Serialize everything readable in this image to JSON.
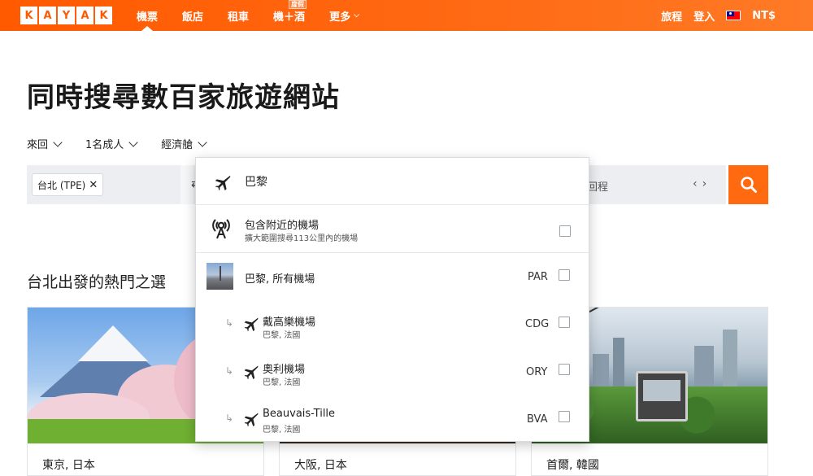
{
  "header": {
    "logo_letters": [
      "K",
      "A",
      "Y",
      "A",
      "K"
    ],
    "nav": [
      {
        "label": "機票",
        "active": true
      },
      {
        "label": "飯店",
        "active": false
      },
      {
        "label": "租車",
        "active": false
      },
      {
        "label": "機＋酒",
        "active": false,
        "badge": "度假"
      },
      {
        "label": "更多",
        "active": false,
        "has_chevron": true
      }
    ],
    "right": {
      "trips": "旅程",
      "login": "登入",
      "currency": "NT$"
    }
  },
  "hero": {
    "title": "同時搜尋數百家旅遊網站"
  },
  "options": {
    "trip_type": "來回",
    "travelers": "1名成人",
    "cabin": "經濟艙"
  },
  "search": {
    "origin_chip": "台北 (TPE)",
    "destination_value": "巴黎",
    "date_label": "回程"
  },
  "dropdown": {
    "nearby": {
      "title": "包含附近的機場",
      "subtitle": "擴大範圍搜尋113公里內的機場"
    },
    "city": {
      "name": "巴黎, 所有機場",
      "code": "PAR"
    },
    "airports": [
      {
        "name": "戴高樂機場",
        "location": "巴黎, 法國",
        "code": "CDG"
      },
      {
        "name": "奧利機場",
        "location": "巴黎, 法國",
        "code": "ORY"
      },
      {
        "name": "Beauvais-Tille",
        "location": "巴黎, 法國",
        "code": "BVA"
      }
    ]
  },
  "popular": {
    "title": "台北出發的熱門之選",
    "cards": [
      {
        "caption": "東京, 日本"
      },
      {
        "caption": "大阪, 日本"
      },
      {
        "caption": "首爾, 韓國"
      }
    ]
  },
  "colors": {
    "brand": "#ff5a00",
    "search_button": "#ff690f"
  }
}
